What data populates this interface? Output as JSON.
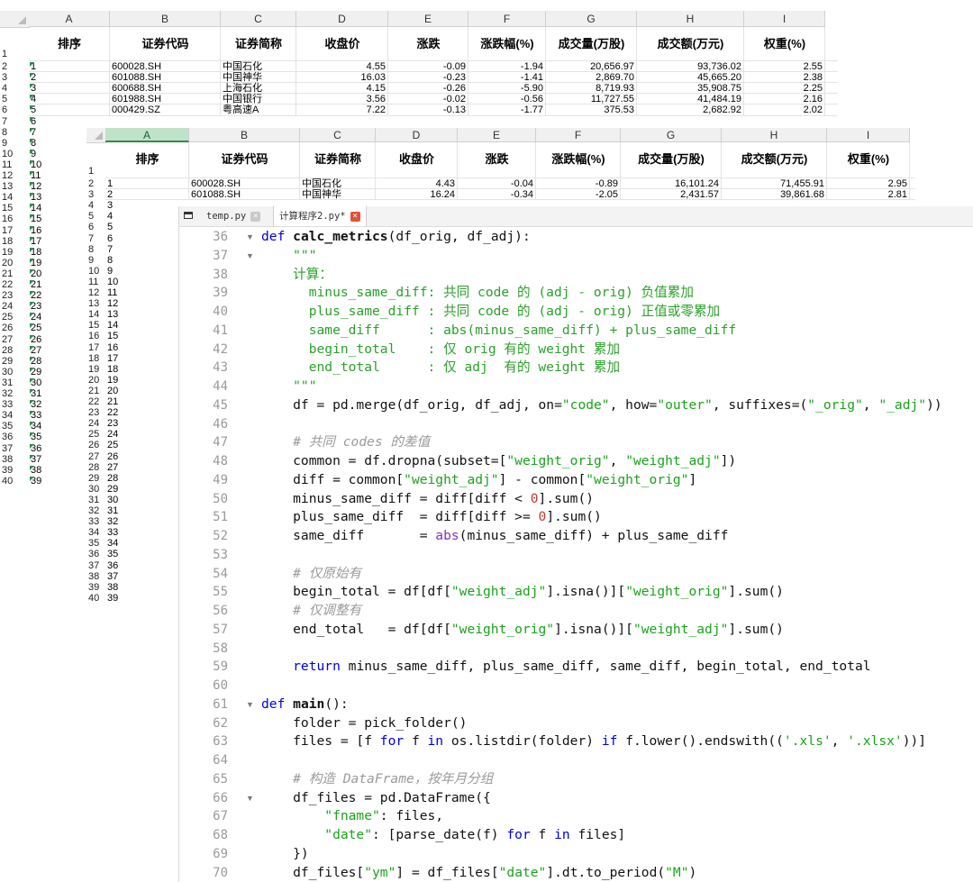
{
  "sheet_back": {
    "columns": [
      "A",
      "B",
      "C",
      "D",
      "E",
      "F",
      "G",
      "H",
      "I"
    ],
    "header": [
      "排序",
      "证券代码",
      "证券简称",
      "收盘价",
      "涨跌",
      "涨跌幅(%)",
      "成交量(万股)",
      "成交额(万元)",
      "权重(%)"
    ],
    "row_numbers": [
      "1",
      "2",
      "3",
      "4",
      "5",
      "6",
      "7",
      "8",
      "9",
      "10",
      "11",
      "12",
      "13",
      "14",
      "15",
      "16",
      "17",
      "18",
      "19",
      "20",
      "21",
      "22",
      "23",
      "24",
      "25",
      "26",
      "27",
      "28",
      "29",
      "30",
      "31",
      "32",
      "33",
      "34",
      "35",
      "36",
      "37",
      "38",
      "39",
      "40"
    ],
    "rank_values": [
      "1",
      "2",
      "3",
      "4",
      "5",
      "6",
      "7",
      "8",
      "9",
      "10",
      "11",
      "12",
      "13",
      "14",
      "15",
      "16",
      "17",
      "18",
      "19",
      "20",
      "21",
      "22",
      "23",
      "24",
      "25",
      "26",
      "27",
      "28",
      "29",
      "30",
      "31",
      "32",
      "33",
      "34",
      "35",
      "36",
      "37",
      "38",
      "39"
    ],
    "rows": [
      [
        "1",
        "600028.SH",
        "中国石化",
        "4.55",
        "-0.09",
        "-1.94",
        "20,656.97",
        "93,736.02",
        "2.55"
      ],
      [
        "2",
        "601088.SH",
        "中国神华",
        "16.03",
        "-0.23",
        "-1.41",
        "2,869.70",
        "45,665.20",
        "2.38"
      ],
      [
        "3",
        "600688.SH",
        "上海石化",
        "4.15",
        "-0.26",
        "-5.90",
        "8,719.93",
        "35,908.75",
        "2.25"
      ],
      [
        "4",
        "601988.SH",
        "中国银行",
        "3.56",
        "-0.02",
        "-0.56",
        "11,727.55",
        "41,484.19",
        "2.16"
      ],
      [
        "5",
        "000429.SZ",
        "粤高速A",
        "7.22",
        "-0.13",
        "-1.77",
        "375.53",
        "2,682.92",
        "2.02"
      ]
    ]
  },
  "sheet_front": {
    "columns": [
      "A",
      "B",
      "C",
      "D",
      "E",
      "F",
      "G",
      "H",
      "I"
    ],
    "header": [
      "排序",
      "证券代码",
      "证券简称",
      "收盘价",
      "涨跌",
      "涨跌幅(%)",
      "成交量(万股)",
      "成交额(万元)",
      "权重(%)"
    ],
    "row_numbers": [
      "1",
      "2",
      "3",
      "4",
      "5",
      "6",
      "7",
      "8",
      "9",
      "10",
      "11",
      "12",
      "13",
      "14",
      "15",
      "16",
      "17",
      "18",
      "19",
      "20",
      "21",
      "22",
      "23",
      "24",
      "25",
      "26",
      "27",
      "28",
      "29",
      "30",
      "31",
      "32",
      "33",
      "34",
      "35",
      "36",
      "37",
      "38",
      "39",
      "40"
    ],
    "rank_values": [
      "1",
      "2",
      "3",
      "4",
      "5",
      "6",
      "7",
      "8",
      "9",
      "10",
      "11",
      "12",
      "13",
      "14",
      "15",
      "16",
      "17",
      "18",
      "19",
      "20",
      "21",
      "22",
      "23",
      "24",
      "25",
      "26",
      "27",
      "28",
      "29",
      "30",
      "31",
      "32",
      "33",
      "34",
      "35",
      "36",
      "37",
      "38",
      "39"
    ],
    "rows": [
      [
        "1",
        "600028.SH",
        "中国石化",
        "4.43",
        "-0.04",
        "-0.89",
        "16,101.24",
        "71,455.91",
        "2.95"
      ],
      [
        "2",
        "601088.SH",
        "中国神华",
        "16.24",
        "-0.34",
        "-2.05",
        "2,431.57",
        "39,861.68",
        "2.81"
      ]
    ]
  },
  "editor": {
    "tabs": [
      {
        "label": "temp.py",
        "close": "×"
      },
      {
        "label": "计算程序2.py*",
        "close": "×"
      }
    ],
    "lines": [
      {
        "n": "36",
        "fold": "▼",
        "t": [
          [
            "kw",
            "def "
          ],
          [
            "fn",
            "calc_metrics"
          ],
          [
            "",
            "(df_orig, df_adj):"
          ]
        ]
      },
      {
        "n": "37",
        "fold": "▼",
        "t": [
          [
            "doc",
            "    \"\"\""
          ]
        ]
      },
      {
        "n": "38",
        "t": [
          [
            "doc",
            "    计算："
          ]
        ]
      },
      {
        "n": "39",
        "t": [
          [
            "doc",
            "      minus_same_diff: 共同 code 的 (adj - orig) 负值累加"
          ]
        ]
      },
      {
        "n": "40",
        "t": [
          [
            "doc",
            "      plus_same_diff : 共同 code 的 (adj - orig) 正值或零累加"
          ]
        ]
      },
      {
        "n": "41",
        "t": [
          [
            "doc",
            "      same_diff      : abs(minus_same_diff) + plus_same_diff"
          ]
        ]
      },
      {
        "n": "42",
        "t": [
          [
            "doc",
            "      begin_total    : 仅 orig 有的 weight 累加"
          ]
        ]
      },
      {
        "n": "43",
        "t": [
          [
            "doc",
            "      end_total      : 仅 adj  有的 weight 累加"
          ]
        ]
      },
      {
        "n": "44",
        "t": [
          [
            "doc",
            "    \"\"\""
          ]
        ]
      },
      {
        "n": "45",
        "t": [
          [
            "",
            "    df = pd.merge(df_orig, df_adj, on="
          ],
          [
            "str",
            "\"code\""
          ],
          [
            "",
            ", how="
          ],
          [
            "str",
            "\"outer\""
          ],
          [
            "",
            ", suffixes=("
          ],
          [
            "str",
            "\"_orig\""
          ],
          [
            "",
            ", "
          ],
          [
            "str",
            "\"_adj\""
          ],
          [
            "",
            "))"
          ]
        ]
      },
      {
        "n": "46",
        "t": []
      },
      {
        "n": "47",
        "t": [
          [
            "com",
            "    # 共同 codes 的差值"
          ]
        ]
      },
      {
        "n": "48",
        "t": [
          [
            "",
            "    common = df.dropna(subset=["
          ],
          [
            "str",
            "\"weight_orig\""
          ],
          [
            "",
            ", "
          ],
          [
            "str",
            "\"weight_adj\""
          ],
          [
            "",
            "])"
          ]
        ]
      },
      {
        "n": "49",
        "t": [
          [
            "",
            "    diff = common["
          ],
          [
            "str",
            "\"weight_adj\""
          ],
          [
            "",
            "] - common["
          ],
          [
            "str",
            "\"weight_orig\""
          ],
          [
            "",
            "]"
          ]
        ]
      },
      {
        "n": "50",
        "t": [
          [
            "",
            "    minus_same_diff = diff[diff < "
          ],
          [
            "num",
            "0"
          ],
          [
            "",
            "].sum()"
          ]
        ]
      },
      {
        "n": "51",
        "t": [
          [
            "",
            "    plus_same_diff  = diff[diff >= "
          ],
          [
            "num",
            "0"
          ],
          [
            "",
            "].sum()"
          ]
        ]
      },
      {
        "n": "52",
        "t": [
          [
            "",
            "    same_diff       = "
          ],
          [
            "bi",
            "abs"
          ],
          [
            "",
            "(minus_same_diff) + plus_same_diff"
          ]
        ]
      },
      {
        "n": "53",
        "t": []
      },
      {
        "n": "54",
        "t": [
          [
            "com",
            "    # 仅原始有"
          ]
        ]
      },
      {
        "n": "55",
        "t": [
          [
            "",
            "    begin_total = df[df["
          ],
          [
            "str",
            "\"weight_adj\""
          ],
          [
            "",
            "].isna()]["
          ],
          [
            "str",
            "\"weight_orig\""
          ],
          [
            "",
            "].sum()"
          ]
        ]
      },
      {
        "n": "56",
        "t": [
          [
            "com",
            "    # 仅调整有"
          ]
        ]
      },
      {
        "n": "57",
        "t": [
          [
            "",
            "    end_total   = df[df["
          ],
          [
            "str",
            "\"weight_orig\""
          ],
          [
            "",
            "].isna()]["
          ],
          [
            "str",
            "\"weight_adj\""
          ],
          [
            "",
            "].sum()"
          ]
        ]
      },
      {
        "n": "58",
        "t": []
      },
      {
        "n": "59",
        "t": [
          [
            "kw",
            "    return "
          ],
          [
            "",
            "minus_same_diff, plus_same_diff, same_diff, begin_total, end_total"
          ]
        ]
      },
      {
        "n": "60",
        "t": []
      },
      {
        "n": "61",
        "fold": "▼",
        "t": [
          [
            "kw",
            "def "
          ],
          [
            "fn",
            "main"
          ],
          [
            "",
            "():"
          ]
        ]
      },
      {
        "n": "62",
        "t": [
          [
            "",
            "    folder = pick_folder()"
          ]
        ]
      },
      {
        "n": "63",
        "t": [
          [
            "",
            "    files = [f "
          ],
          [
            "kw",
            "for"
          ],
          [
            "",
            " f "
          ],
          [
            "kw",
            "in"
          ],
          [
            "",
            " os.listdir(folder) "
          ],
          [
            "kw",
            "if"
          ],
          [
            "",
            " f.lower().endswith(("
          ],
          [
            "str",
            "'.xls'"
          ],
          [
            "",
            ", "
          ],
          [
            "str",
            "'.xlsx'"
          ],
          [
            "",
            "))]"
          ]
        ]
      },
      {
        "n": "64",
        "t": []
      },
      {
        "n": "65",
        "t": [
          [
            "com",
            "    # 构造 DataFrame，按年月分组"
          ]
        ]
      },
      {
        "n": "66",
        "fold": "▼",
        "t": [
          [
            "",
            "    df_files = pd.DataFrame({"
          ]
        ]
      },
      {
        "n": "67",
        "t": [
          [
            "str",
            "        \"fname\""
          ],
          [
            "",
            ": files,"
          ]
        ]
      },
      {
        "n": "68",
        "t": [
          [
            "str",
            "        \"date\""
          ],
          [
            "",
            ": [parse_date(f) "
          ],
          [
            "kw",
            "for"
          ],
          [
            "",
            " f "
          ],
          [
            "kw",
            "in"
          ],
          [
            "",
            " files]"
          ]
        ]
      },
      {
        "n": "69",
        "t": [
          [
            "",
            "    })"
          ]
        ]
      },
      {
        "n": "70",
        "t": [
          [
            "",
            "    df_files["
          ],
          [
            "str",
            "\"ym\""
          ],
          [
            "",
            "] = df_files["
          ],
          [
            "str",
            "\"date\""
          ],
          [
            "",
            "].dt.to_period("
          ],
          [
            "str",
            "\"M\""
          ],
          [
            "",
            ")"
          ]
        ]
      }
    ]
  }
}
